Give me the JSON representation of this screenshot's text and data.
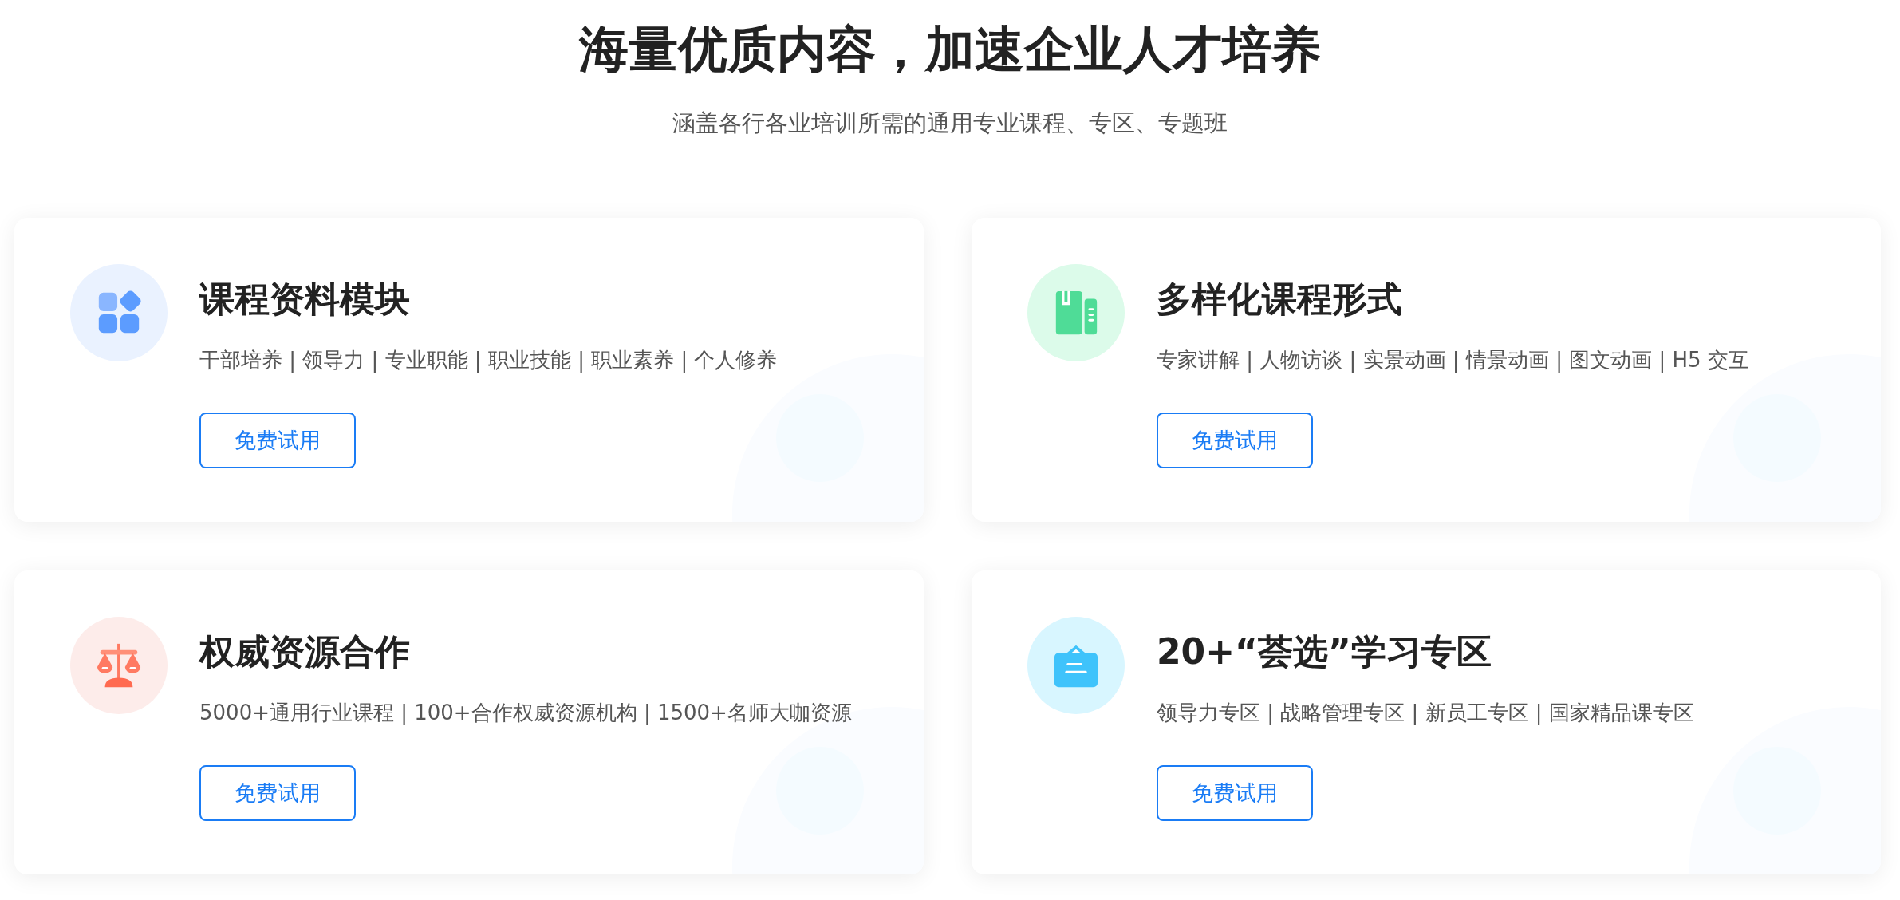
{
  "heading": "海量优质内容，加速企业人才培养",
  "subheading": "涵盖各行各业培训所需的通用专业课程、专区、专题班",
  "cards": [
    {
      "kind": "blocks",
      "title": "课程资料模块",
      "tags": "干部培养 | 领导力 | 专业职能 | 职业技能 | 职业素养 | 个人修养",
      "button": "免费试用"
    },
    {
      "kind": "book",
      "title": "多样化课程形式",
      "tags": "专家讲解 | 人物访谈 | 实景动画 | 情景动画 | 图文动画 | H5 交互",
      "button": "免费试用"
    },
    {
      "kind": "scales",
      "title": "权威资源合作",
      "tags": "5000+通用行业课程 | 100+合作权威资源机构 | 1500+名师大咖资源",
      "button": "免费试用"
    },
    {
      "kind": "bag",
      "title": "20+“荟选”学习专区",
      "tags": "领导力专区 | 战略管理专区 | 新员工专区 | 国家精品课专区",
      "button": "免费试用"
    }
  ]
}
